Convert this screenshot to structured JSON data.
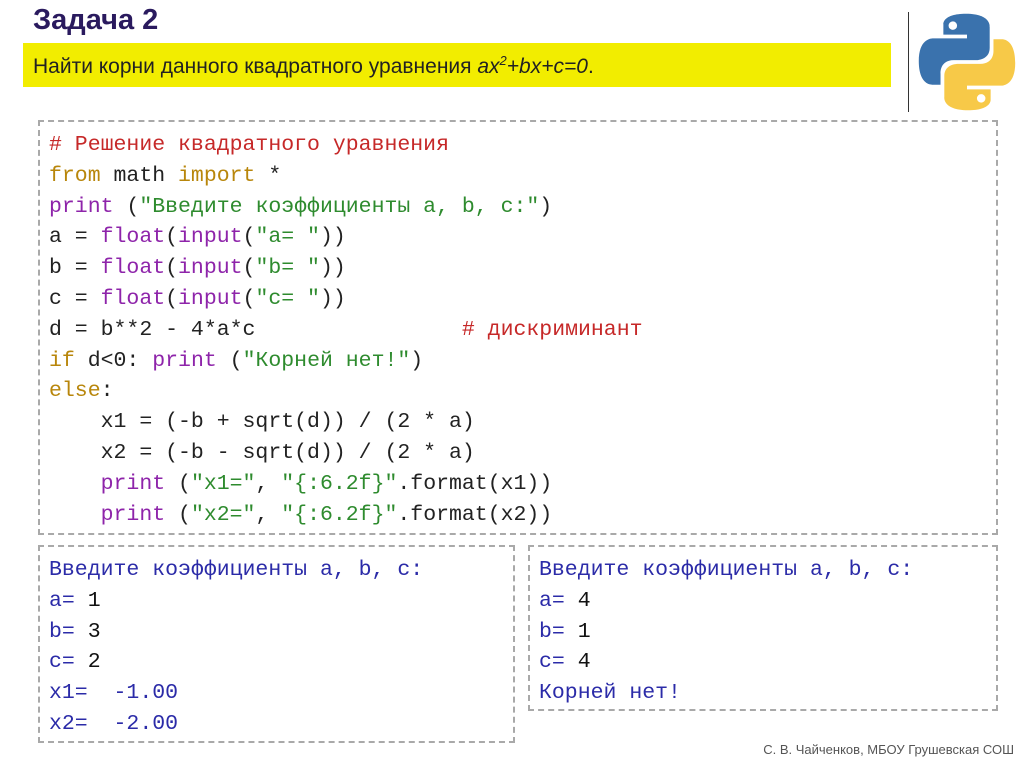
{
  "header": {
    "title": "Задача 2",
    "task_text": "Найти корни данного квадратного уравнения ",
    "equation_prefix": "ax",
    "equation_exp": "2",
    "equation_suffix": "+bx+c=0",
    "task_end": "."
  },
  "logo": {
    "name": "python-logo",
    "colors": {
      "blue": "#3776ab",
      "yellow": "#ffd43b"
    }
  },
  "code": {
    "lines": [
      [
        {
          "t": "# Решение квадратного уравнения",
          "k": "com"
        }
      ],
      [
        {
          "t": "from",
          "k": "kw"
        },
        {
          "t": " math ",
          "k": "pl"
        },
        {
          "t": "import",
          "k": "kw"
        },
        {
          "t": " *",
          "k": "pl"
        }
      ],
      [
        {
          "t": "print",
          "k": "bi"
        },
        {
          "t": " (",
          "k": "pl"
        },
        {
          "t": "\"Введите коэффициенты a, b, c:\"",
          "k": "str"
        },
        {
          "t": ")",
          "k": "pl"
        }
      ],
      [
        {
          "t": "a = ",
          "k": "pl"
        },
        {
          "t": "float",
          "k": "bi"
        },
        {
          "t": "(",
          "k": "pl"
        },
        {
          "t": "input",
          "k": "bi"
        },
        {
          "t": "(",
          "k": "pl"
        },
        {
          "t": "\"a= \"",
          "k": "str"
        },
        {
          "t": "))",
          "k": "pl"
        }
      ],
      [
        {
          "t": "b = ",
          "k": "pl"
        },
        {
          "t": "float",
          "k": "bi"
        },
        {
          "t": "(",
          "k": "pl"
        },
        {
          "t": "input",
          "k": "bi"
        },
        {
          "t": "(",
          "k": "pl"
        },
        {
          "t": "\"b= \"",
          "k": "str"
        },
        {
          "t": "))",
          "k": "pl"
        }
      ],
      [
        {
          "t": "c = ",
          "k": "pl"
        },
        {
          "t": "float",
          "k": "bi"
        },
        {
          "t": "(",
          "k": "pl"
        },
        {
          "t": "input",
          "k": "bi"
        },
        {
          "t": "(",
          "k": "pl"
        },
        {
          "t": "\"c= \"",
          "k": "str"
        },
        {
          "t": "))",
          "k": "pl"
        }
      ],
      [
        {
          "t": "d = b**2 - 4*a*c                ",
          "k": "pl"
        },
        {
          "t": "# дискриминант",
          "k": "com"
        }
      ],
      [
        {
          "t": "if",
          "k": "kw"
        },
        {
          "t": " d<0: ",
          "k": "pl"
        },
        {
          "t": "print",
          "k": "bi"
        },
        {
          "t": " (",
          "k": "pl"
        },
        {
          "t": "\"Корней нет!\"",
          "k": "str"
        },
        {
          "t": ")",
          "k": "pl"
        }
      ],
      [
        {
          "t": "else",
          "k": "kw"
        },
        {
          "t": ":",
          "k": "pl"
        }
      ],
      [
        {
          "t": "    x1 = (-b + sqrt(d)) / (2 * a)",
          "k": "pl"
        }
      ],
      [
        {
          "t": "    x2 = (-b - sqrt(d)) / (2 * a)",
          "k": "pl"
        }
      ],
      [
        {
          "t": "    ",
          "k": "pl"
        },
        {
          "t": "print",
          "k": "bi"
        },
        {
          "t": " (",
          "k": "pl"
        },
        {
          "t": "\"x1=\"",
          "k": "str"
        },
        {
          "t": ", ",
          "k": "pl"
        },
        {
          "t": "\"{:6.2f}\"",
          "k": "str"
        },
        {
          "t": ".format(x1))",
          "k": "pl"
        }
      ],
      [
        {
          "t": "    ",
          "k": "pl"
        },
        {
          "t": "print",
          "k": "bi"
        },
        {
          "t": " (",
          "k": "pl"
        },
        {
          "t": "\"x2=\"",
          "k": "str"
        },
        {
          "t": ", ",
          "k": "pl"
        },
        {
          "t": "\"{:6.2f}\"",
          "k": "str"
        },
        {
          "t": ".format(x2))",
          "k": "pl"
        }
      ]
    ]
  },
  "output1": {
    "lines": [
      [
        {
          "t": "Введите коэффициенты a, b, c:",
          "k": "out"
        }
      ],
      [
        {
          "t": "a= ",
          "k": "out"
        },
        {
          "t": "1",
          "k": "val"
        }
      ],
      [
        {
          "t": "b= ",
          "k": "out"
        },
        {
          "t": "3",
          "k": "val"
        }
      ],
      [
        {
          "t": "c= ",
          "k": "out"
        },
        {
          "t": "2",
          "k": "val"
        }
      ],
      [
        {
          "t": "x1=  -1.00",
          "k": "out"
        }
      ],
      [
        {
          "t": "x2=  -2.00",
          "k": "out"
        }
      ]
    ]
  },
  "output2": {
    "lines": [
      [
        {
          "t": "Введите коэффициенты a, b, c:",
          "k": "out"
        }
      ],
      [
        {
          "t": "a= ",
          "k": "out"
        },
        {
          "t": "4",
          "k": "val"
        }
      ],
      [
        {
          "t": "b= ",
          "k": "out"
        },
        {
          "t": "1",
          "k": "val"
        }
      ],
      [
        {
          "t": "c= ",
          "k": "out"
        },
        {
          "t": "4",
          "k": "val"
        }
      ],
      [
        {
          "t": "Корней нет!",
          "k": "out"
        }
      ]
    ]
  },
  "footer": {
    "author": "С. В. Чайченков, МБОУ Грушевская СОШ"
  }
}
